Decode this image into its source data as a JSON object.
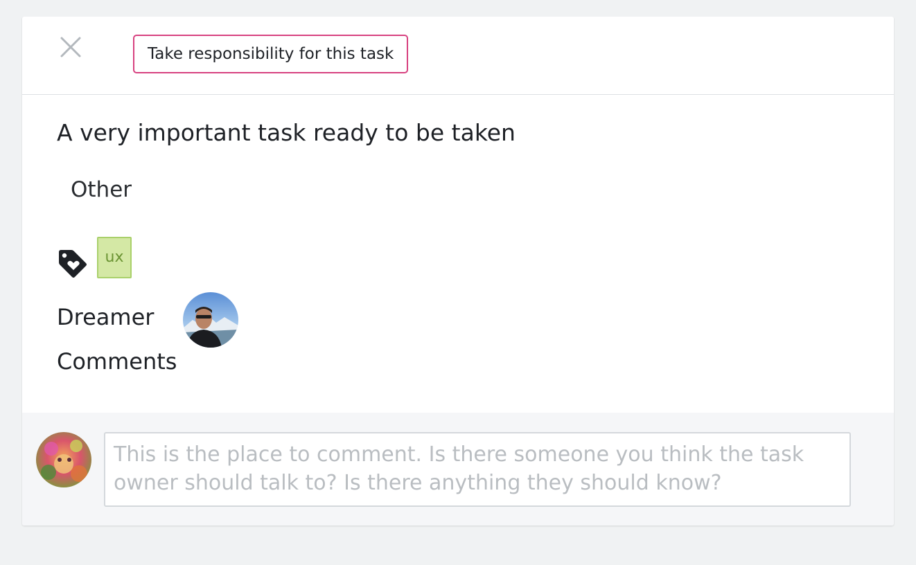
{
  "header": {
    "close_icon": "close-icon",
    "take_button_label": "Take responsibility for this task",
    "accent_color": "#d7407f"
  },
  "task": {
    "title": "A very important task ready to be taken",
    "category": "Other",
    "tags_icon": "tag-heart-icon",
    "tags": [
      "ux"
    ],
    "tag_color": "#d4e8a5",
    "dreamer_label": "Dreamer",
    "dreamer_avatar": "user-avatar",
    "comments_label": "Comments"
  },
  "comment": {
    "avatar": "current-user-avatar",
    "placeholder": "This is the place to comment. Is there someone you think the task owner should talk to? Is there anything they should know?",
    "value": ""
  }
}
